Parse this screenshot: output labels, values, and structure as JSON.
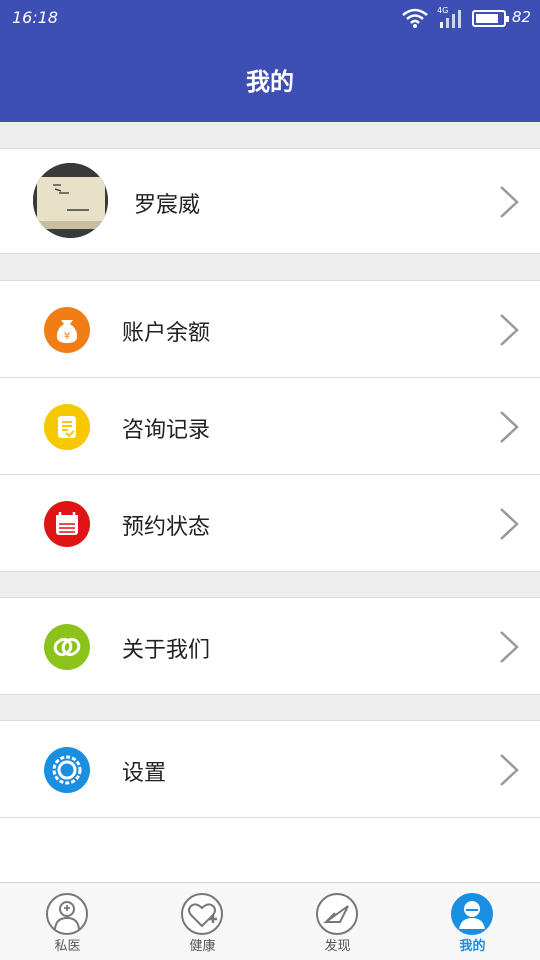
{
  "status": {
    "time": "16:18",
    "network": "4G",
    "battery": "82",
    "battery_level": 0.82
  },
  "header": {
    "title": "我的"
  },
  "profile": {
    "name": "罗宸威"
  },
  "menu": [
    {
      "label": "账户余额",
      "icon": "money-bag-icon",
      "color": "#f07e14"
    },
    {
      "label": "咨询记录",
      "icon": "record-icon",
      "color": "#f5c800"
    },
    {
      "label": "预约状态",
      "icon": "calendar-icon",
      "color": "#e01414"
    },
    {
      "label": "关于我们",
      "icon": "link-icon",
      "color": "#8cc21c"
    },
    {
      "label": "设置",
      "icon": "gear-icon",
      "color": "#1a8fe0"
    }
  ],
  "tabs": [
    {
      "label": "私医",
      "icon": "doctor-icon"
    },
    {
      "label": "健康",
      "icon": "heart-plus-icon"
    },
    {
      "label": "发现",
      "icon": "discover-icon"
    },
    {
      "label": "我的",
      "icon": "user-icon",
      "active": true
    }
  ],
  "colors": {
    "primary": "#3d4fb5",
    "tab_active": "#1a8fe0"
  }
}
